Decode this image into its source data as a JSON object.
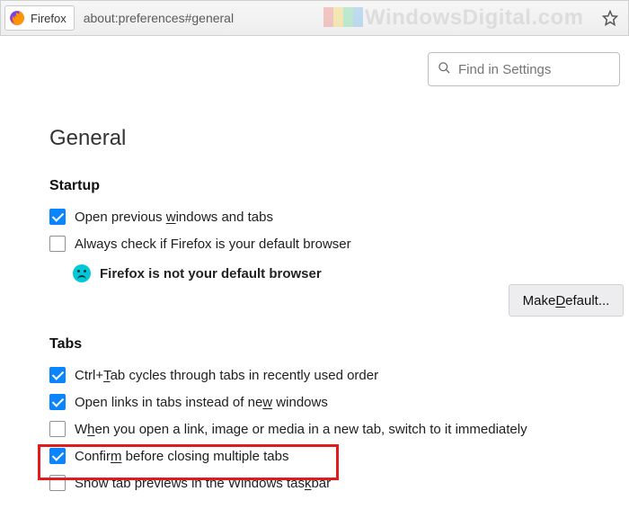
{
  "addrbar": {
    "product": "Firefox",
    "url": "about:preferences#general"
  },
  "watermark": {
    "text": "WindowsDigital.com"
  },
  "search": {
    "placeholder": "Find in Settings"
  },
  "page_title": "General",
  "startup": {
    "heading": "Startup",
    "open_previous": {
      "checked": true,
      "pre": "Open previous ",
      "u": "w",
      "post": "indows and tabs"
    },
    "always_check": {
      "checked": false,
      "text": "Always check if Firefox is your default browser"
    },
    "not_default": "Firefox is not your default browser",
    "make_default_pre": "Make ",
    "make_default_u": "D",
    "make_default_post": "efault..."
  },
  "tabs": {
    "heading": "Tabs",
    "ctrl_tab": {
      "checked": true,
      "pre": "Ctrl+",
      "u": "T",
      "mid": "ab cycles through tabs in recently used order"
    },
    "open_links": {
      "checked": true,
      "pre": "Open links in tabs instead of ne",
      "u": "w",
      "post": " windows"
    },
    "switch_now": {
      "checked": false,
      "pre": "W",
      "u": "h",
      "post": "en you open a link, image or media in a new tab, switch to it immediately"
    },
    "confirm": {
      "checked": true,
      "pre": "Confir",
      "u": "m",
      "post": " before closing multiple tabs"
    },
    "taskbar": {
      "checked": false,
      "pre": "Show tab previews in the Windows tas",
      "u": "k",
      "post": "bar"
    }
  }
}
